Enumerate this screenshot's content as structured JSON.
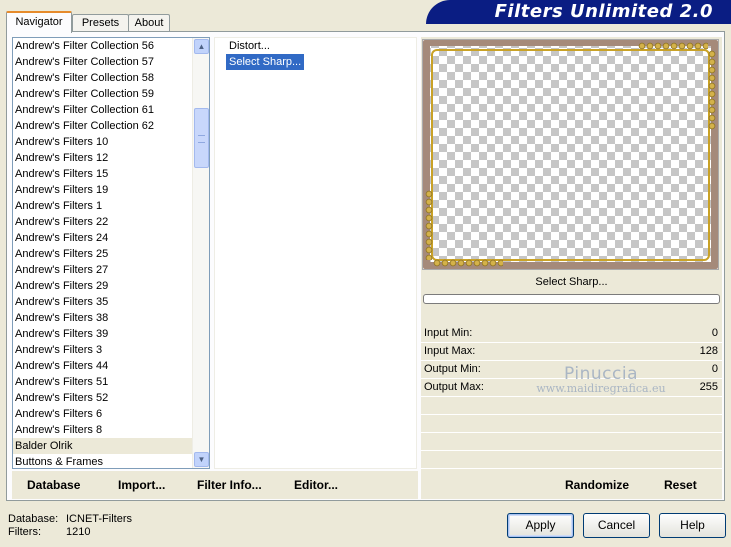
{
  "app": {
    "title": "Filters Unlimited 2.0"
  },
  "tabs": [
    {
      "label": "Navigator"
    },
    {
      "label": "Presets"
    },
    {
      "label": "About"
    }
  ],
  "categories": {
    "items": [
      "Andrew's Filter Collection 56",
      "Andrew's Filter Collection 57",
      "Andrew's Filter Collection 58",
      "Andrew's Filter Collection 59",
      "Andrew's Filter Collection 61",
      "Andrew's Filter Collection 62",
      "Andrew's Filters 10",
      "Andrew's Filters 12",
      "Andrew's Filters 15",
      "Andrew's Filters 19",
      "Andrew's Filters 1",
      "Andrew's Filters 22",
      "Andrew's Filters 24",
      "Andrew's Filters 25",
      "Andrew's Filters 27",
      "Andrew's Filters 29",
      "Andrew's Filters 35",
      "Andrew's Filters 38",
      "Andrew's Filters 39",
      "Andrew's Filters 3",
      "Andrew's Filters 44",
      "Andrew's Filters 51",
      "Andrew's Filters 52",
      "Andrew's Filters 6",
      "Andrew's Filters 8",
      "Balder Olrik",
      "Buttons & Frames"
    ],
    "selected": "Balder Olrik"
  },
  "filters": {
    "items": [
      "Distort...",
      "Select Sharp..."
    ],
    "selected": "Select Sharp..."
  },
  "preview": {
    "label": "Select Sharp...",
    "progress": 0
  },
  "parameters": [
    {
      "label": "Input Min:",
      "value": "0"
    },
    {
      "label": "Input Max:",
      "value": "128"
    },
    {
      "label": "Output Min:",
      "value": "0"
    },
    {
      "label": "Output Max:",
      "value": "255"
    }
  ],
  "watermark": {
    "name": "Pinuccia",
    "site": "www.maidiregrafica.eu"
  },
  "toolbar": {
    "database": "Database",
    "import": "Import...",
    "filter_info": "Filter Info...",
    "editor": "Editor...",
    "randomize": "Randomize",
    "reset": "Reset"
  },
  "status": {
    "database_label": "Database:",
    "database_value": "ICNET-Filters",
    "filters_label": "Filters:",
    "filters_value": "1210"
  },
  "dialog": {
    "apply": "Apply",
    "cancel": "Cancel",
    "help": "Help"
  },
  "colors": {
    "banner": "#0a1d83",
    "selection": "#316ac5",
    "tab_highlight": "#e68b2c"
  }
}
